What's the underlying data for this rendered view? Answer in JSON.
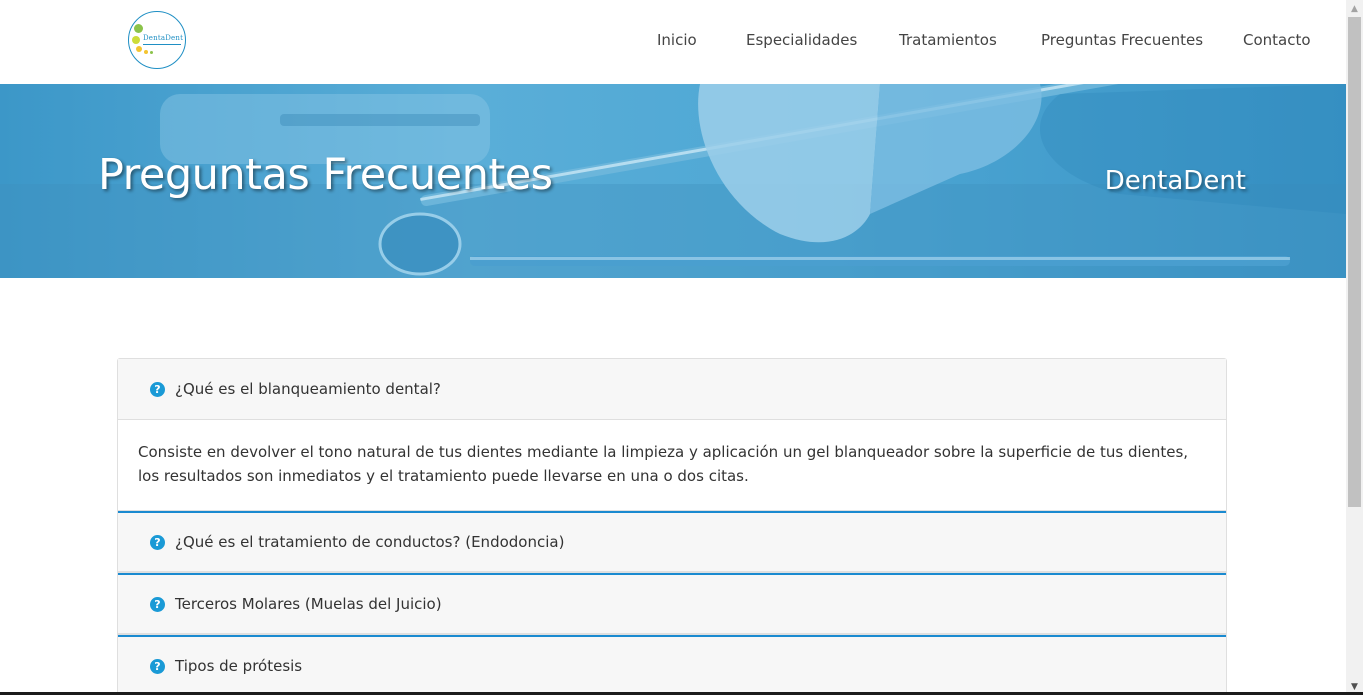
{
  "logo": {
    "name": "DentaDent logo",
    "brand_text": "DentaDent",
    "colors": [
      "#8bc34a",
      "#cddc39",
      "#f4c430",
      "#1f8fc4"
    ]
  },
  "nav": {
    "items": [
      {
        "label": "Inicio"
      },
      {
        "label": "Especialidades"
      },
      {
        "label": "Tratamientos"
      },
      {
        "label": "Preguntas Frecuentes"
      },
      {
        "label": "Contacto"
      }
    ]
  },
  "hero": {
    "title": "Preguntas Frecuentes",
    "brand": "DentaDent"
  },
  "faq": {
    "icon": "question-circle-icon",
    "accent_color": "#1a8ad0",
    "items": [
      {
        "question": "¿Qué es el blanqueamiento dental?",
        "answer": "Consiste en devolver el tono natural de tus dientes mediante la limpieza y aplicación un gel blanqueador sobre la superficie de tus dientes, los resultados son inmediatos y el tratamiento puede llevarse en una o dos citas.",
        "expanded": true
      },
      {
        "question": "¿Qué es el tratamiento de conductos? (Endodoncia)",
        "expanded": false
      },
      {
        "question": "Terceros Molares (Muelas del Juicio)",
        "expanded": false
      },
      {
        "question": "Tipos de prótesis",
        "expanded": false
      }
    ]
  }
}
